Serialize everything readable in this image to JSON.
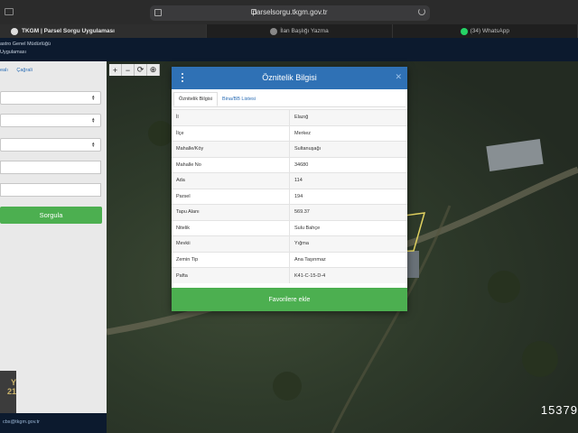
{
  "browser": {
    "url": "parselsorgu.tkgm.gov.tr",
    "tabs": [
      {
        "label": "TKGM | Parsel Sorgu Uygulaması",
        "active": true
      },
      {
        "label": "İlan Başlığı Yazma",
        "active": false
      },
      {
        "label": "(34) WhatsApp",
        "active": false
      }
    ]
  },
  "header": {
    "line1": "astro Genel Müdürlüğü",
    "line2": "Uygulaması"
  },
  "left_panel": {
    "links": [
      "ealı",
      "Çağrali"
    ],
    "query_button": "Sorgula",
    "footer_email": "cbs@tkgm.gov.tr",
    "promo_text": "Y 21"
  },
  "map": {
    "tools": [
      "+",
      "−",
      "⟳",
      "⊕"
    ],
    "overlay_number": "15379"
  },
  "modal": {
    "title": "Öznitelik Bilgisi",
    "tabs": [
      "Öznitelik Bilgisi",
      "Bina/BB Listesi"
    ],
    "rows": [
      {
        "key": "İl",
        "value": "Elazığ"
      },
      {
        "key": "İlçe",
        "value": "Merkez"
      },
      {
        "key": "Mahalle/Köy",
        "value": "Sultanuşağı"
      },
      {
        "key": "Mahalle No",
        "value": "34680"
      },
      {
        "key": "Ada",
        "value": "114"
      },
      {
        "key": "Parsel",
        "value": "194"
      },
      {
        "key": "Tapu Alanı",
        "value": "569.37"
      },
      {
        "key": "Nitelik",
        "value": "Sulu Bahçe"
      },
      {
        "key": "Mevkii",
        "value": "Yığma"
      },
      {
        "key": "Zemin Tip",
        "value": "Ana Taşınmaz"
      },
      {
        "key": "Pafta",
        "value": "K41-C-15-D-4"
      }
    ],
    "favorite_button": "Favorilere ekle"
  },
  "colors": {
    "header_blue": "#2f71b5",
    "green": "#4caf50",
    "app_header": "#0c1a2e"
  }
}
